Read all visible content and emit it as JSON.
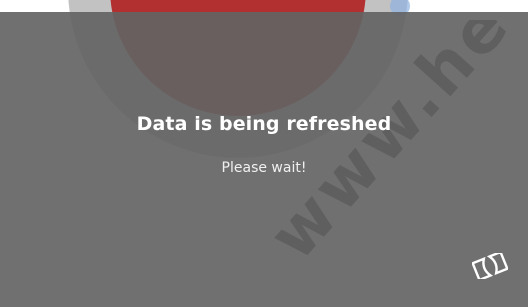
{
  "loading_dialog": {
    "title": "Data is being refreshed",
    "subtitle": "Please wait!"
  },
  "icons": {
    "logo": "dolby-style-logo-icon"
  },
  "colors": {
    "overlay": "#646464",
    "text": "#ffffff",
    "background_circle": "#8b1a1a"
  }
}
